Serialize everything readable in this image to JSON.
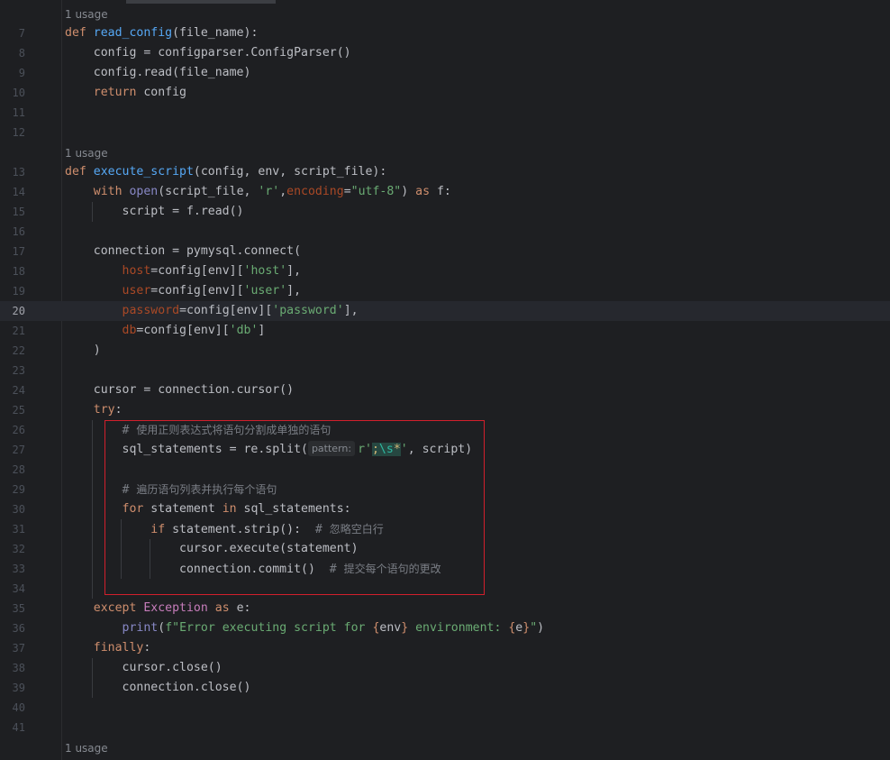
{
  "editor": {
    "current_line": "20",
    "usage_hints": [
      "1 usage",
      "1 usage",
      "1 usage"
    ],
    "param_hint": "pattern:",
    "lines": [
      {
        "num": "7",
        "text": "def read_config(file_name):"
      },
      {
        "num": "8",
        "text": "config = configparser.ConfigParser()"
      },
      {
        "num": "9",
        "text": "config.read(file_name)"
      },
      {
        "num": "10",
        "text": "return config"
      },
      {
        "num": "11",
        "text": ""
      },
      {
        "num": "12",
        "text": ""
      },
      {
        "num": "13",
        "text": "def execute_script(config, env, script_file):"
      },
      {
        "num": "14",
        "text": "with open(script_file, 'r',encoding=\"utf-8\") as f:"
      },
      {
        "num": "15",
        "text": "script = f.read()"
      },
      {
        "num": "16",
        "text": ""
      },
      {
        "num": "17",
        "text": "connection = pymysql.connect("
      },
      {
        "num": "18",
        "text": "host=config[env]['host'],"
      },
      {
        "num": "19",
        "text": "user=config[env]['user'],"
      },
      {
        "num": "20",
        "text": "password=config[env]['password'],"
      },
      {
        "num": "21",
        "text": "db=config[env]['db']"
      },
      {
        "num": "22",
        "text": ")"
      },
      {
        "num": "23",
        "text": ""
      },
      {
        "num": "24",
        "text": "cursor = connection.cursor()"
      },
      {
        "num": "25",
        "text": "try:"
      },
      {
        "num": "26",
        "text": "# 使用正则表达式将语句分割成单独的语句"
      },
      {
        "num": "27",
        "text": "sql_statements = re.split(r';\\s*', script)"
      },
      {
        "num": "28",
        "text": ""
      },
      {
        "num": "29",
        "text": "# 遍历语句列表并执行每个语句"
      },
      {
        "num": "30",
        "text": "for statement in sql_statements:"
      },
      {
        "num": "31",
        "text": "if statement.strip():  # 忽略空白行"
      },
      {
        "num": "32",
        "text": "cursor.execute(statement)"
      },
      {
        "num": "33",
        "text": "connection.commit()  # 提交每个语句的更改"
      },
      {
        "num": "34",
        "text": ""
      },
      {
        "num": "35",
        "text": "except Exception as e:"
      },
      {
        "num": "36",
        "text": "print(f\"Error executing script for {env} environment: {e}\")"
      },
      {
        "num": "37",
        "text": "finally:"
      },
      {
        "num": "38",
        "text": "cursor.close()"
      },
      {
        "num": "39",
        "text": "connection.close()"
      },
      {
        "num": "40",
        "text": ""
      },
      {
        "num": "41",
        "text": ""
      }
    ]
  },
  "colors": {
    "background": "#1e1f22",
    "keyword": "#cf8e6d",
    "function": "#56a8f5",
    "string": "#6aab73",
    "kwarg": "#aa4926",
    "comment": "#7a7e85",
    "highlight_box": "#d21f2c"
  }
}
